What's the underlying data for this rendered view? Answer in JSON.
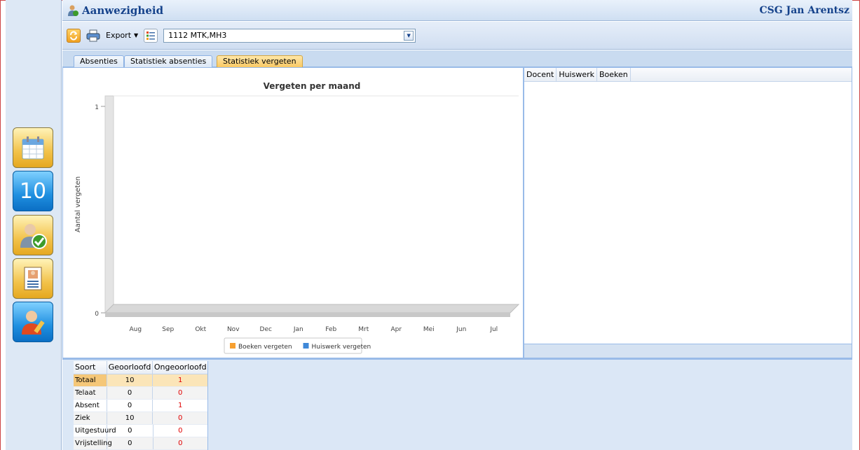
{
  "title_bar": {
    "title": "Aanwezigheid",
    "school": "CSG Jan Arentsz"
  },
  "toolbar": {
    "export_label": "Export",
    "class_select_value": "1112 MTK,MH3"
  },
  "tabs": [
    {
      "label": "Absenties"
    },
    {
      "label": "Statistiek absenties"
    },
    {
      "label": "Statistiek vergeten"
    }
  ],
  "active_tab": "Statistiek vergeten",
  "sidebar": {
    "button_2_label": "10"
  },
  "chart_data": {
    "type": "bar",
    "title": "Vergeten per maand",
    "xlabel": "",
    "ylabel": "Aantal vergeten",
    "categories": [
      "Aug",
      "Sep",
      "Okt",
      "Nov",
      "Dec",
      "Jan",
      "Feb",
      "Mrt",
      "Apr",
      "Mei",
      "Jun",
      "Jul"
    ],
    "series": [
      {
        "name": "Boeken vergeten",
        "color": "#f7a030",
        "values": [
          0,
          0,
          0,
          0,
          0,
          0,
          0,
          0,
          0,
          0,
          0,
          0
        ]
      },
      {
        "name": "Huiswerk vergeten",
        "color": "#3f88d8",
        "values": [
          0,
          0,
          0,
          0,
          0,
          0,
          0,
          0,
          0,
          0,
          0,
          0
        ]
      }
    ],
    "ylim": [
      0,
      1
    ],
    "yticks": [
      "0",
      "1"
    ],
    "grid": false,
    "legend_position": "bottom",
    "style": "3d"
  },
  "right_grid": {
    "columns": [
      "Docent",
      "Huiswerk",
      "Boeken"
    ]
  },
  "summary_table": {
    "headers": [
      "Soort",
      "Geoorloofd",
      "Ongeoorloofd"
    ],
    "rows": [
      {
        "soort": "Totaal",
        "geoorloofd": "10",
        "ongeoorloofd": "1"
      },
      {
        "soort": "Telaat",
        "geoorloofd": "0",
        "ongeoorloofd": "0"
      },
      {
        "soort": "Absent",
        "geoorloofd": "0",
        "ongeoorloofd": "1"
      },
      {
        "soort": "Ziek",
        "geoorloofd": "10",
        "ongeoorloofd": "0"
      },
      {
        "soort": "Uitgestuurd",
        "geoorloofd": "0",
        "ongeoorloofd": "0"
      },
      {
        "soort": "Vrijstelling",
        "geoorloofd": "0",
        "ongeoorloofd": "0"
      }
    ]
  }
}
